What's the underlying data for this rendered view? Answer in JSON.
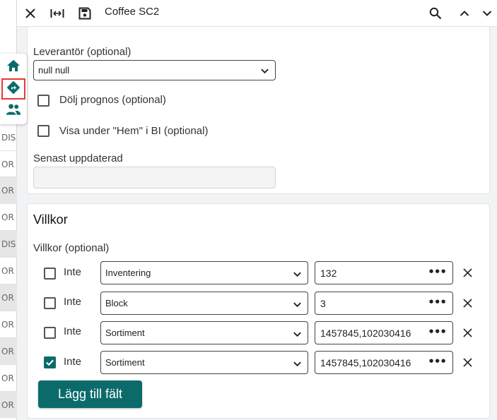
{
  "left_strip": [
    "DIS",
    "OR",
    "OR",
    "OR",
    "DIS",
    "OR",
    "OR",
    "OR",
    "OR",
    "OR",
    "OR"
  ],
  "toolbar": {
    "title": "Coffee SC2",
    "icons": [
      "close-icon",
      "fit-width-icon",
      "save-icon",
      "search-icon",
      "chevron-up-icon",
      "chevron-down-icon"
    ]
  },
  "nav": {
    "items": [
      "home-icon",
      "directions-icon",
      "people-icon"
    ],
    "active": "directions-icon"
  },
  "form": {
    "supplier_label": "Leverantör (optional)",
    "supplier_value": "null null",
    "hide_forecast_label": "Dölj prognos (optional)",
    "show_home_label": "Visa under \"Hem\" i BI (optional)",
    "last_updated_label": "Senast uppdaterad",
    "last_updated_value": ""
  },
  "conditions": {
    "title": "Villkor",
    "subtitle": "Villkor (optional)",
    "rows": [
      {
        "not_label": "Inte",
        "checked": false,
        "field": "Inventering",
        "value": "132"
      },
      {
        "not_label": "Inte",
        "checked": false,
        "field": "Block",
        "value": "3"
      },
      {
        "not_label": "Inte",
        "checked": false,
        "field": "Sortiment",
        "value": "1457845,102030416"
      },
      {
        "not_label": "Inte",
        "checked": true,
        "field": "Sortiment",
        "value": "1457845,102030416"
      }
    ],
    "add_button": "Lägg till fält",
    "accent": "#0b6b6b"
  }
}
